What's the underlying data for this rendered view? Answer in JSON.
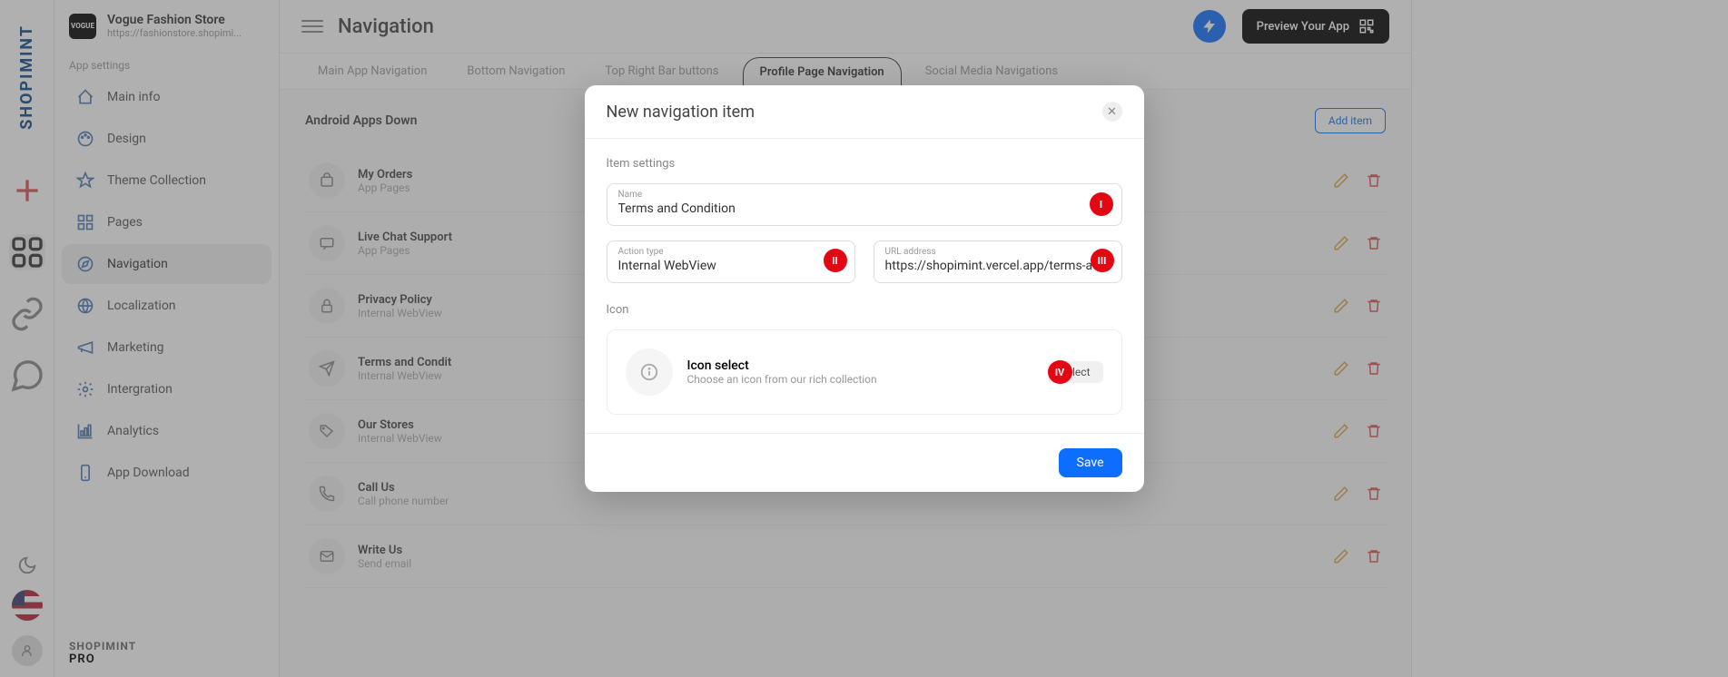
{
  "store": {
    "name": "Vogue Fashion Store",
    "url": "https://fashionstore.shopimi...",
    "logo": "VOGUE"
  },
  "brand": {
    "rail": "SHOPIMINT",
    "footer_brand": "SHOPIMINT",
    "footer_tier": "PRO"
  },
  "sidebar": {
    "section": "App settings",
    "items": [
      {
        "label": "Main info"
      },
      {
        "label": "Design"
      },
      {
        "label": "Theme Collection"
      },
      {
        "label": "Pages"
      },
      {
        "label": "Navigation"
      },
      {
        "label": "Localization"
      },
      {
        "label": "Marketing"
      },
      {
        "label": "Intergration"
      },
      {
        "label": "Analytics"
      },
      {
        "label": "App Download"
      }
    ]
  },
  "topbar": {
    "page_title": "Navigation",
    "preview_label": "Preview Your App"
  },
  "tabs": [
    {
      "label": "Main App Navigation"
    },
    {
      "label": "Bottom Navigation"
    },
    {
      "label": "Top Right Bar buttons"
    },
    {
      "label": "Profile Page Navigation"
    },
    {
      "label": "Social Media Navigations"
    }
  ],
  "content": {
    "title": "Android Apps Down",
    "add_item": "Add item"
  },
  "nav_items": [
    {
      "name": "My Orders",
      "sub": "App Pages"
    },
    {
      "name": "Live Chat Support",
      "sub": "App Pages"
    },
    {
      "name": "Privacy Policy",
      "sub": "Internal WebView"
    },
    {
      "name": "Terms and Condit",
      "sub": "Internal WebView"
    },
    {
      "name": "Our Stores",
      "sub": "Internal WebView"
    },
    {
      "name": "Call Us",
      "sub": "Call phone number"
    },
    {
      "name": "Write Us",
      "sub": "Send email"
    }
  ],
  "modal": {
    "title": "New navigation item",
    "section": "Item settings",
    "name_label": "Name",
    "name_value": "Terms and Condition",
    "action_label": "Action type",
    "action_value": "Internal WebView",
    "url_label": "URL address",
    "url_value": "https://shopimint.vercel.app/terms-a",
    "icon_section": "Icon",
    "icon_title": "Icon select",
    "icon_sub": "Choose an icon from our rich collection",
    "select_label": "Select",
    "save_label": "Save"
  },
  "annotations": {
    "one": "I",
    "two": "II",
    "three": "III",
    "four": "IV"
  }
}
